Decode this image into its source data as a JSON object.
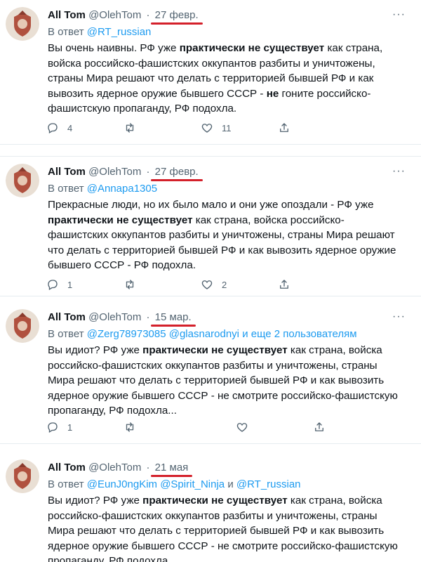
{
  "tweets": [
    {
      "name": "All Tom",
      "handle": "@OlehTom",
      "separator": "·",
      "date": "27 февр.",
      "reply_prefix": "В ответ",
      "mentions": [
        "@RT_russian"
      ],
      "mention_joiner": "",
      "body": {
        "t1": "Вы очень наивны. РФ уже ",
        "b1": "практически не существует",
        "t2": " как страна, войска  российско-фашистских оккупантов разбиты и уничтожены, страны Мира решают что делать с территорией  бывшей РФ и как вывозить ядерное оружие бывшего СССР - ",
        "b2": "не",
        "t3": " гоните российско-фашистскую пропаганду, РФ подохла."
      },
      "reply_count": "4",
      "retweet_count": "",
      "like_count": "11"
    },
    {
      "name": "All Tom",
      "handle": "@OlehTom",
      "separator": "·",
      "date": "27 февр.",
      "reply_prefix": "В ответ",
      "mentions": [
        "@Annapa1305"
      ],
      "body": {
        "t1": "Прекрасные люди, но их было мало и они уже опоздали - РФ уже ",
        "b1": "практически не существует",
        "t2": " как страна, войска  российско-фашистских оккупантов разбиты и уничтожены, страны Мира решают что делать с территорией  бывшей РФ и как вывозить ядерное оружие бывшего СССР - РФ подохла."
      },
      "reply_count": "1",
      "retweet_count": "",
      "like_count": "2"
    },
    {
      "name": "All Tom",
      "handle": "@OlehTom",
      "separator": "·",
      "date": "15 мар.",
      "reply_prefix": "В ответ",
      "mentions": [
        "@Zerg78973085",
        "@glasnarodnyi",
        "и еще 2 пользователям"
      ],
      "body": {
        "t1": "Вы идиот? РФ уже ",
        "b1": "практически не существует",
        "t2": " как страна, войска российско-фашистских оккупантов разбиты и уничтожены, страны Мира решают что делать с территорией  бывшей РФ и как вывозить ядерное оружие бывшего СССР - не смотрите российско-фашистскую пропаганду, РФ подохла..."
      },
      "reply_count": "1",
      "retweet_count": "",
      "like_count": ""
    },
    {
      "name": "All Tom",
      "handle": "@OlehTom",
      "separator": "·",
      "date": "21 мая",
      "reply_prefix": "В ответ",
      "mentions": [
        "@EunJ0ngKim",
        "@Spirit_Ninja",
        "и",
        "@RT_russian"
      ],
      "body": {
        "t1": "Вы идиот? РФ уже ",
        "b1": "практически не существует",
        "t2": " как страна, войска российско-фашистских оккупантов разбиты и уничтожены, страны Мира решают что делать с территорией  бывшей РФ и как вывозить ядерное оружие бывшего СССР - не смотрите российско-фашистскую пропаганду, РФ подохла..."
      },
      "reply_count": "",
      "retweet_count": "",
      "like_count": ""
    }
  ],
  "icons": {
    "reply": "speech-bubble",
    "retweet": "retweet-arrows",
    "like": "heart",
    "share": "upload-arrow",
    "more": "horizontal-ellipsis"
  },
  "colors": {
    "link": "#1d9bf0",
    "muted": "#536471",
    "highlight_underline": "#d4202a",
    "avatar_bg": "#d9c9b9",
    "avatar_crest": "#a94a3a"
  },
  "more_glyph": "···"
}
